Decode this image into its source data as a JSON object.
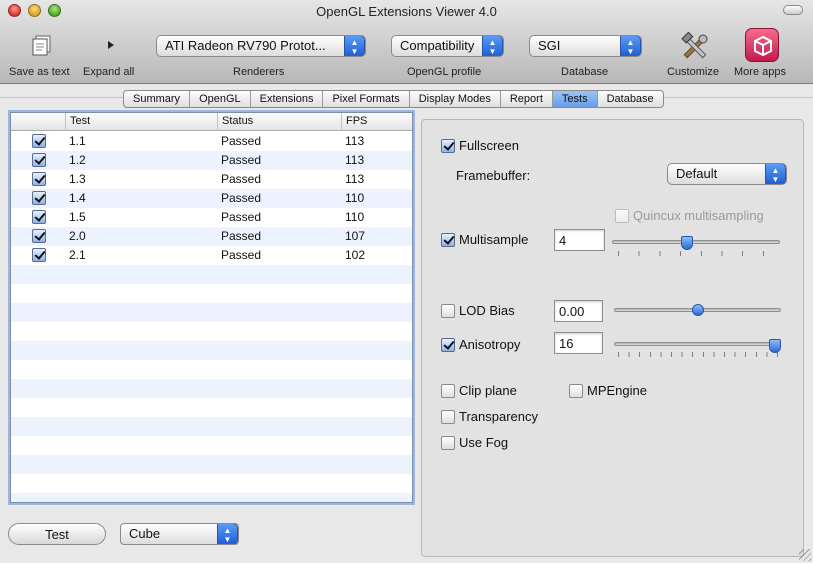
{
  "window": {
    "title": "OpenGL Extensions Viewer 4.0"
  },
  "toolbar": {
    "save_label": "Save as text",
    "expand_label": "Expand all",
    "renderers": {
      "value": "ATI Radeon RV790 Protot...",
      "label": "Renderers"
    },
    "profile": {
      "value": "Compatibility",
      "label": "OpenGL profile"
    },
    "database": {
      "value": "SGI",
      "label": "Database"
    },
    "customize_label": "Customize",
    "more_apps_label": "More apps"
  },
  "tabs": [
    "Summary",
    "OpenGL",
    "Extensions",
    "Pixel Formats",
    "Display Modes",
    "Report",
    "Tests",
    "Database"
  ],
  "active_tab": "Tests",
  "table": {
    "columns": [
      "Test",
      "Status",
      "FPS"
    ],
    "rows": [
      {
        "checked": true,
        "test": "1.1",
        "status": "Passed",
        "fps": "113"
      },
      {
        "checked": true,
        "test": "1.2",
        "status": "Passed",
        "fps": "113"
      },
      {
        "checked": true,
        "test": "1.3",
        "status": "Passed",
        "fps": "113"
      },
      {
        "checked": true,
        "test": "1.4",
        "status": "Passed",
        "fps": "110"
      },
      {
        "checked": true,
        "test": "1.5",
        "status": "Passed",
        "fps": "110"
      },
      {
        "checked": true,
        "test": "2.0",
        "status": "Passed",
        "fps": "107"
      },
      {
        "checked": true,
        "test": "2.1",
        "status": "Passed",
        "fps": "102"
      }
    ]
  },
  "bottom": {
    "test_button": "Test",
    "shape": "Cube"
  },
  "options": {
    "fullscreen": {
      "label": "Fullscreen",
      "checked": true
    },
    "framebuffer": {
      "label": "Framebuffer:",
      "value": "Default"
    },
    "quincux": {
      "label": "Quincux multisampling",
      "checked": false,
      "enabled": false
    },
    "multisample": {
      "label": "Multisample",
      "checked": true,
      "value": "4",
      "slider_level": 0.44
    },
    "lod_bias": {
      "label": "LOD Bias",
      "checked": false,
      "value": "0.00",
      "slider_level": 0.5
    },
    "anisotropy": {
      "label": "Anisotropy",
      "checked": true,
      "value": "16",
      "slider_level": 1.0
    },
    "clip_plane": {
      "label": "Clip plane",
      "checked": false
    },
    "mpengine": {
      "label": "MPEngine",
      "checked": false
    },
    "transparency": {
      "label": "Transparency",
      "checked": false
    },
    "use_fog": {
      "label": "Use Fog",
      "checked": false
    }
  },
  "colors": {
    "accent": "#3b7ae6",
    "selected_tab": "#7aaef0"
  },
  "icons": {
    "save": "document-stack-icon",
    "expand": "triangle-right-icon",
    "customize": "tools-icon",
    "more_apps": "app-store-icon"
  }
}
